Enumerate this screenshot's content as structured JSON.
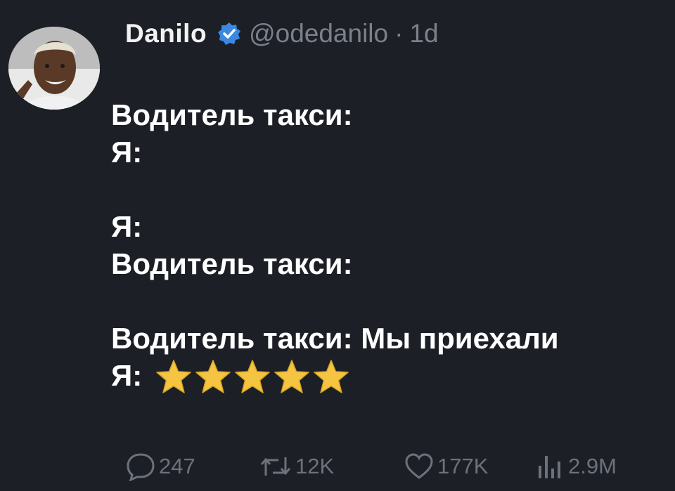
{
  "post": {
    "author": {
      "display_name": "Danilo",
      "handle": "@odedanilo",
      "separator": "·",
      "time": "1d",
      "verified": true,
      "avatar_icon": "user-avatar"
    },
    "lines": {
      "l1": "Водитель такси:",
      "l2": "Я:",
      "l3": "Я:",
      "l4": "Водитель такси:",
      "l5": "Водитель такси: Мы приехали",
      "l6": "Я:"
    },
    "rating": {
      "stars": 5,
      "max": 5,
      "icon": "star-icon",
      "color": "#f5c542"
    },
    "stats": {
      "replies": "247",
      "reposts": "12K",
      "likes": "177K",
      "views": "2.9M"
    }
  },
  "colors": {
    "background": "#1c1f26",
    "text": "#ffffff",
    "muted": "#7b818b",
    "verified_badge": "#3a88e0"
  }
}
